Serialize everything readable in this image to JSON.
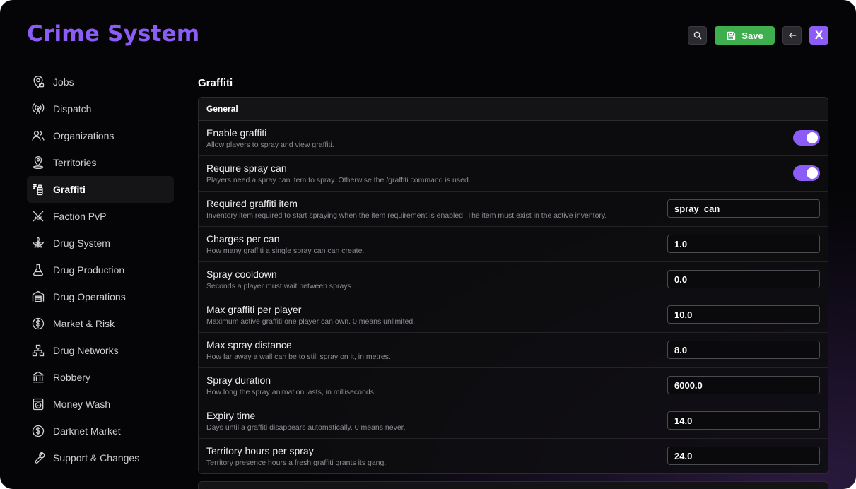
{
  "app": {
    "title": "Crime System"
  },
  "toolbar": {
    "save_label": "Save",
    "close_label": "X"
  },
  "colors": {
    "accent": "#8b5cf6",
    "save": "#3fae4f"
  },
  "sidebar": {
    "items": [
      {
        "label": "Jobs",
        "icon": "map-pin-icon"
      },
      {
        "label": "Dispatch",
        "icon": "antenna-icon"
      },
      {
        "label": "Organizations",
        "icon": "users-icon"
      },
      {
        "label": "Territories",
        "icon": "map-marker-person-icon"
      },
      {
        "label": "Graffiti",
        "icon": "spray-can-icon",
        "active": true
      },
      {
        "label": "Faction PvP",
        "icon": "crossed-swords-icon"
      },
      {
        "label": "Drug System",
        "icon": "leaf-icon"
      },
      {
        "label": "Drug Production",
        "icon": "flask-icon"
      },
      {
        "label": "Drug Operations",
        "icon": "warehouse-icon"
      },
      {
        "label": "Market & Risk",
        "icon": "dollar-circle-icon"
      },
      {
        "label": "Drug Networks",
        "icon": "network-icon"
      },
      {
        "label": "Robbery",
        "icon": "bank-icon"
      },
      {
        "label": "Money Wash",
        "icon": "washing-machine-icon"
      },
      {
        "label": "Darknet Market",
        "icon": "dollar-badge-icon"
      },
      {
        "label": "Support & Changes",
        "icon": "wrench-icon"
      }
    ]
  },
  "main": {
    "section_title": "Graffiti",
    "panel_title": "General",
    "settings": [
      {
        "title": "Enable graffiti",
        "description": "Allow players to spray and view graffiti.",
        "type": "toggle",
        "value": true
      },
      {
        "title": "Require spray can",
        "description": "Players need a spray can item to spray. Otherwise the /graffiti command is used.",
        "type": "toggle",
        "value": true
      },
      {
        "title": "Required graffiti item",
        "description": "Inventory item required to start spraying when the item requirement is enabled. The item must exist in the active inventory.",
        "type": "input",
        "value": "spray_can"
      },
      {
        "title": "Charges per can",
        "description": "How many graffiti a single spray can can create.",
        "type": "input",
        "value": "1.0"
      },
      {
        "title": "Spray cooldown",
        "description": "Seconds a player must wait between sprays.",
        "type": "input",
        "value": "0.0"
      },
      {
        "title": "Max graffiti per player",
        "description": "Maximum active graffiti one player can own. 0 means unlimited.",
        "type": "input",
        "value": "10.0"
      },
      {
        "title": "Max spray distance",
        "description": "How far away a wall can be to still spray on it, in metres.",
        "type": "input",
        "value": "8.0"
      },
      {
        "title": "Spray duration",
        "description": "How long the spray animation lasts, in milliseconds.",
        "type": "input",
        "value": "6000.0"
      },
      {
        "title": "Expiry time",
        "description": "Days until a graffiti disappears automatically. 0 means never.",
        "type": "input",
        "value": "14.0"
      },
      {
        "title": "Territory hours per spray",
        "description": "Territory presence hours a fresh graffiti grants its gang.",
        "type": "input",
        "value": "24.0"
      }
    ]
  }
}
